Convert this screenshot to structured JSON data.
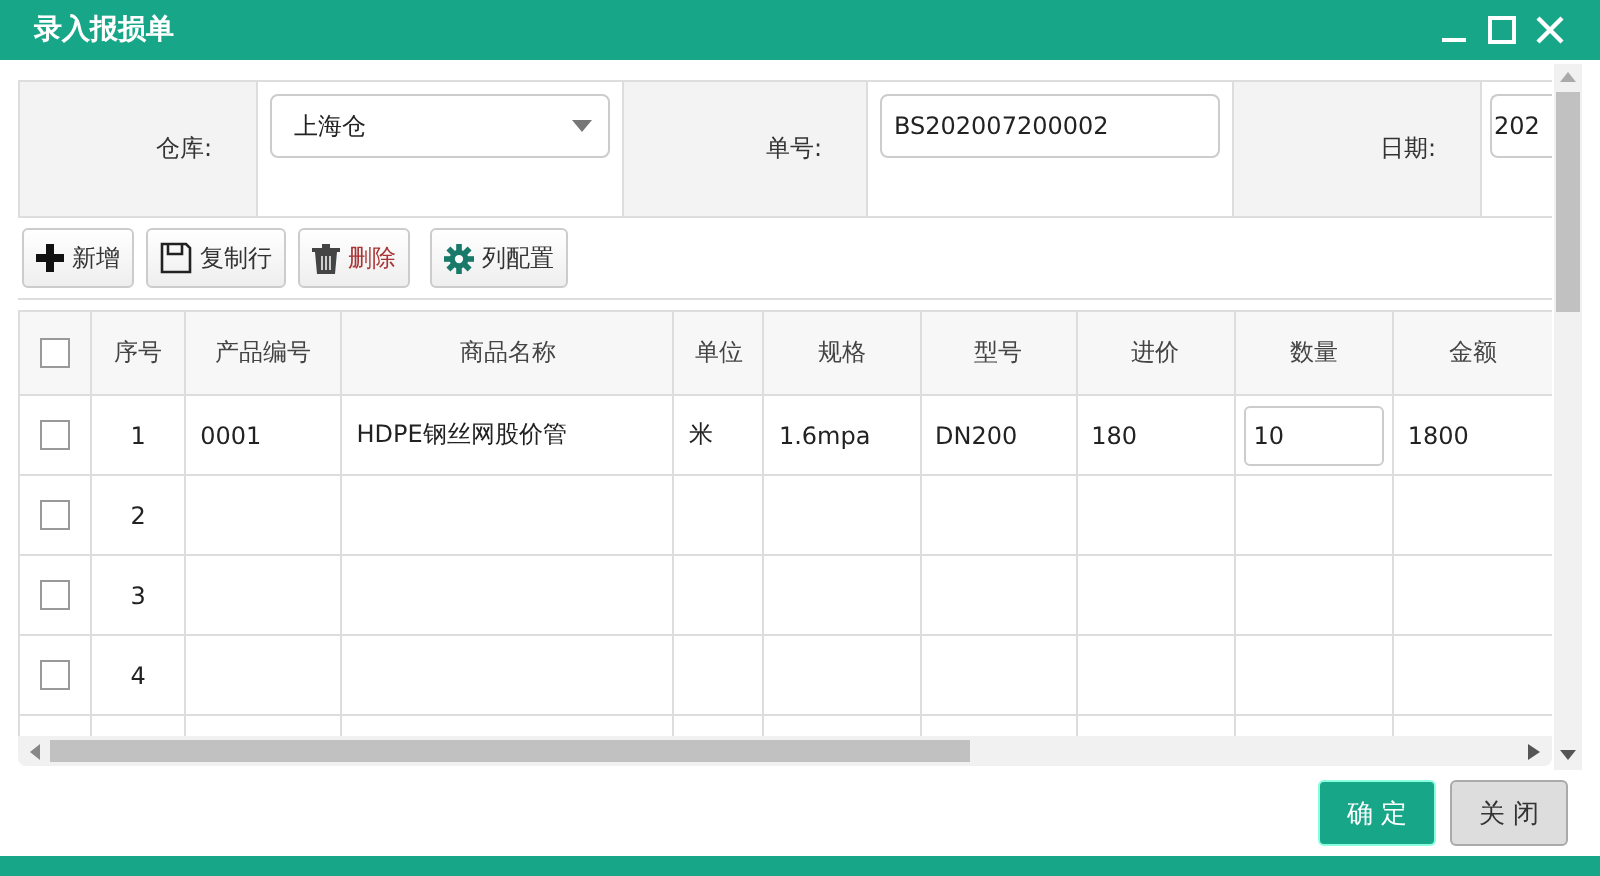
{
  "window": {
    "title": "录入报损单"
  },
  "form": [
    {
      "label": "仓库:",
      "kind": "select",
      "value": "上海仓"
    },
    {
      "label": "单号:",
      "kind": "text",
      "value": "BS202007200002"
    },
    {
      "label": "日期:",
      "kind": "text",
      "value": "202"
    }
  ],
  "toolbar": [
    {
      "label": "新增"
    },
    {
      "label": "复制行"
    },
    {
      "label": "删除"
    },
    {
      "label": "列配置"
    }
  ],
  "table": {
    "header_checked": false,
    "columns": [
      "序号",
      "产品编号",
      "商品名称",
      "单位",
      "规格",
      "型号",
      "进价",
      "数量",
      "金额"
    ],
    "rows": [
      {
        "checked": false,
        "cells": [
          "1",
          "0001",
          "HDPE钢丝网股价管",
          "米",
          "1.6mpa",
          "DN200",
          "180",
          "10",
          "1800"
        ]
      },
      {
        "checked": false,
        "cells": [
          "2"
        ]
      },
      {
        "checked": false,
        "cells": [
          "3"
        ]
      },
      {
        "checked": false,
        "cells": [
          "4"
        ]
      },
      {
        "cells": []
      }
    ]
  },
  "buttons": [
    {
      "label": "确 定",
      "kind": "primary"
    },
    {
      "label": "关 闭",
      "kind": "default"
    }
  ]
}
